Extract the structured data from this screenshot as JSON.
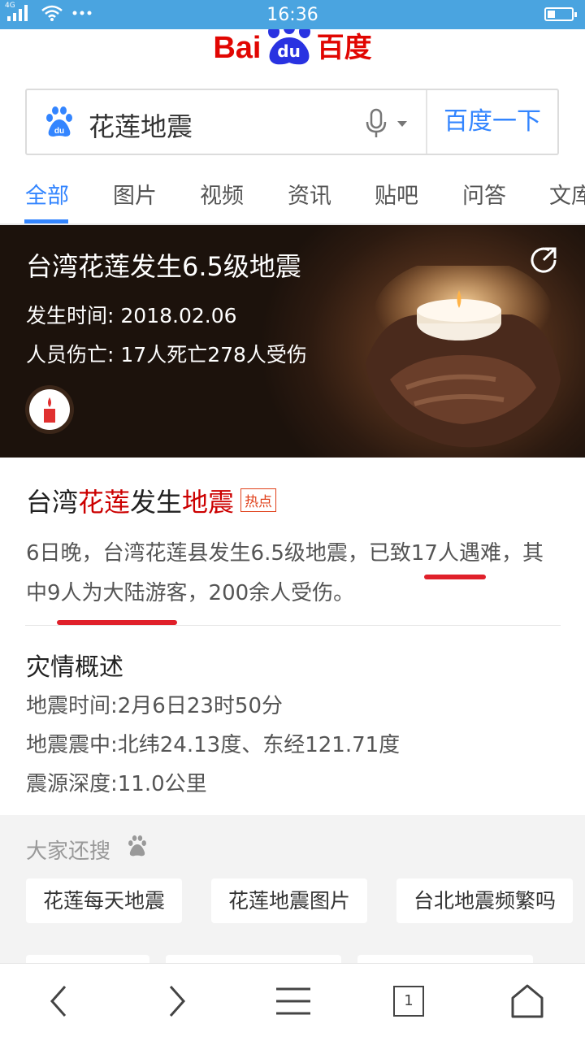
{
  "status_bar": {
    "time": "16:36",
    "network": "4G"
  },
  "header": {
    "logo_text_left": "Bai",
    "logo_text_du": "du",
    "logo_text_right": "百度"
  },
  "search": {
    "query": "花莲地震",
    "button_label": "百度一下"
  },
  "tabs": [
    {
      "label": "全部",
      "active": true
    },
    {
      "label": "图片"
    },
    {
      "label": "视频"
    },
    {
      "label": "资讯"
    },
    {
      "label": "贴吧"
    },
    {
      "label": "问答"
    },
    {
      "label": "文库"
    }
  ],
  "hero_card": {
    "title": "台湾花莲发生6.5级地震",
    "time_label": "发生时间:",
    "time_value": "2018.02.06",
    "casualty_label": "人员伤亡:",
    "casualty_value": "17人死亡278人受伤"
  },
  "news": {
    "headline_parts": [
      "台湾",
      "花莲",
      "发生",
      "地震"
    ],
    "hot_badge": "热点",
    "summary": "6日晚，台湾花莲县发生6.5级地震，已致17人遇难，其中9人为大陆游客，200余人受伤。"
  },
  "disaster_overview": {
    "title": "灾情概述",
    "rows": [
      {
        "label": "地震时间:",
        "value": "2月6日23时50分"
      },
      {
        "label": "地震震中:",
        "value": "北纬24.13度、东经121.71度"
      },
      {
        "label": "震源深度:",
        "value": "11.0公里"
      }
    ]
  },
  "related_searches": {
    "title": "大家还搜",
    "items": [
      "花莲每天地震",
      "花莲地震图片",
      "台北地震频繁吗"
    ]
  },
  "bottom_nav": {
    "tab_count": "1"
  },
  "colors": {
    "accent": "#3385ff",
    "status_bar": "#4aa4e0",
    "highlight": "#cc0000",
    "annotation": "#e0202a"
  }
}
